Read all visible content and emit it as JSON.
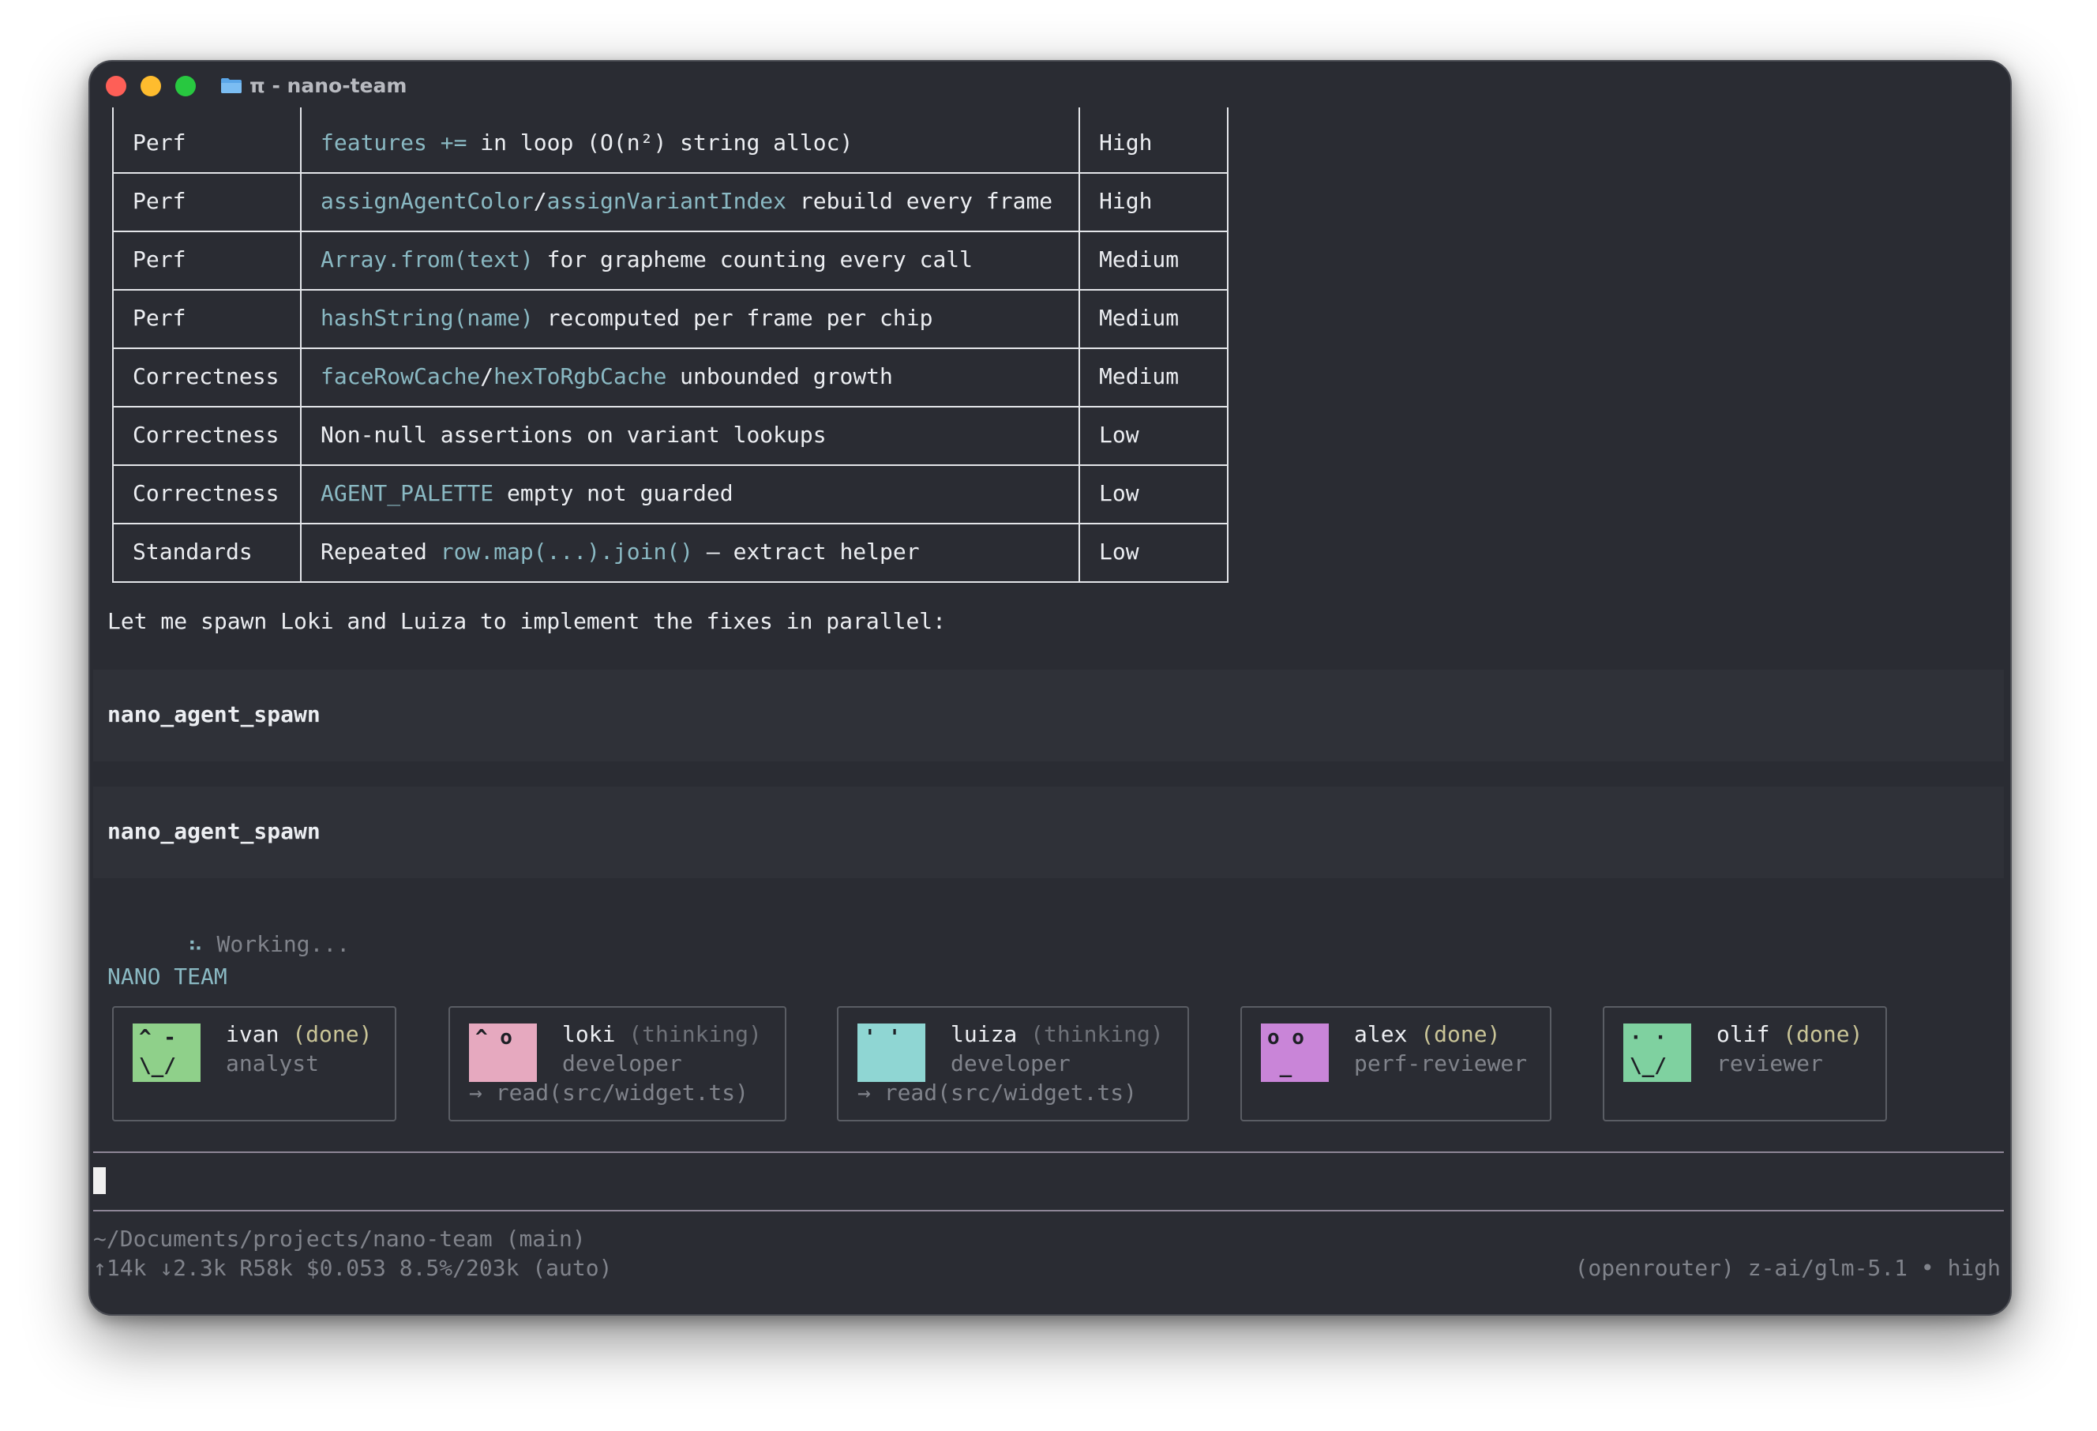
{
  "window": {
    "title": "π - nano-team"
  },
  "table": {
    "rows": [
      {
        "category": "Perf",
        "parts": [
          [
            "features +=",
            "code"
          ],
          [
            " in loop (O(n²) string alloc)",
            "text"
          ]
        ],
        "severity": "High"
      },
      {
        "category": "Perf",
        "parts": [
          [
            "assignAgentColor",
            "code"
          ],
          [
            "/",
            "text"
          ],
          [
            "assignVariantIndex",
            "code"
          ],
          [
            " rebuild every frame",
            "text"
          ]
        ],
        "severity": "High"
      },
      {
        "category": "Perf",
        "parts": [
          [
            "Array.from(text)",
            "code"
          ],
          [
            " for grapheme counting every call",
            "text"
          ]
        ],
        "severity": "Medium"
      },
      {
        "category": "Perf",
        "parts": [
          [
            "hashString(name)",
            "code"
          ],
          [
            " recomputed per frame per chip",
            "text"
          ]
        ],
        "severity": "Medium"
      },
      {
        "category": "Correctness",
        "parts": [
          [
            "faceRowCache",
            "code"
          ],
          [
            "/",
            "text"
          ],
          [
            "hexToRgbCache",
            "code"
          ],
          [
            " unbounded growth",
            "text"
          ]
        ],
        "severity": "Medium"
      },
      {
        "category": "Correctness",
        "parts": [
          [
            "Non-null assertions on variant lookups",
            "text"
          ]
        ],
        "severity": "Low"
      },
      {
        "category": "Correctness",
        "parts": [
          [
            "AGENT_PALETTE",
            "code"
          ],
          [
            " empty not guarded",
            "text"
          ]
        ],
        "severity": "Low"
      },
      {
        "category": "Standards",
        "parts": [
          [
            "Repeated ",
            "text"
          ],
          [
            "row.map(...).join()",
            "code"
          ],
          [
            " — extract helper",
            "text"
          ]
        ],
        "severity": "Low"
      }
    ]
  },
  "message": "Let me spawn Loki and Luiza to implement the fixes in parallel:",
  "tool_calls": [
    "nano_agent_spawn",
    "nano_agent_spawn"
  ],
  "status": {
    "spinner": "⠦",
    "text": "Working..."
  },
  "team": {
    "heading": "NANO TEAM",
    "members": [
      {
        "name": "ivan",
        "state": "(done)",
        "role": "analyst",
        "activity": "",
        "face": "^ -\n\\_/",
        "color": "#8fd08a",
        "state_color": "#c9c497"
      },
      {
        "name": "loki",
        "state": "(thinking)",
        "role": "developer",
        "activity": "→ read(src/widget.ts)",
        "face": "^ o\n",
        "color": "#e6a9bf",
        "state_color": "#6e7178"
      },
      {
        "name": "luiza",
        "state": "(thinking)",
        "role": "developer",
        "activity": "→ read(src/widget.ts)",
        "face": "' '\n",
        "color": "#8fd6d3",
        "state_color": "#6e7178"
      },
      {
        "name": "alex",
        "state": "(done)",
        "role": "perf-reviewer",
        "activity": "",
        "face": "o o\n _",
        "color": "#c985d8",
        "state_color": "#c9c497"
      },
      {
        "name": "olif",
        "state": "(done)",
        "role": "reviewer",
        "activity": "",
        "face": "· ·\n\\_/",
        "color": "#7fd1a0",
        "state_color": "#c9c497"
      }
    ]
  },
  "footer": {
    "path": "~/Documents/projects/nano-team (main)",
    "stats": "↑14k ↓2.3k R58k $0.053 8.5%/203k (auto)",
    "model": "(openrouter) z-ai/glm-5.1 • high"
  }
}
